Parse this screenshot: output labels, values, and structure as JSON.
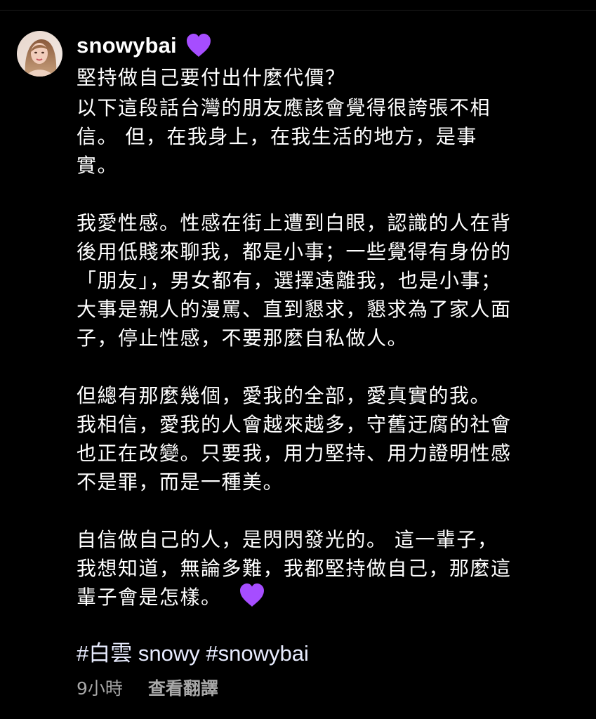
{
  "post": {
    "username": "snowybai",
    "title_heart_icon": "purple-heart-icon",
    "title": "堅持做自己要付出什麼代價？",
    "paragraphs": [
      [
        "以下這段話台灣的朋友應該會覺得很誇張不相",
        "信。 但，在我身上，在我生活的地方，是事",
        "實。"
      ],
      [
        "我愛性感。性感在街上遭到白眼，認識的人在背",
        "後用低賤來聊我，都是小事；一些覺得有身份的",
        "「朋友」，男女都有，選擇遠離我，也是小事；",
        "大事是親人的漫罵、直到懇求，懇求為了家人面",
        "子，停止性感，不要那麼自私做人。"
      ],
      [
        "但總有那麼幾個，愛我的全部，愛真實的我。",
        "我相信，愛我的人會越來越多，守舊迂腐的社會",
        "也正在改變。只要我，用力堅持、用力證明性感",
        "不是罪，而是一種美。"
      ],
      [
        "自信做自己的人，是閃閃發光的。 這一輩子，",
        "我想知道，無論多難，我都堅持做自己，那麼這",
        "輩子會是怎樣。"
      ]
    ],
    "hashtags": [
      "#白雲",
      "snowy",
      "#snowybai"
    ],
    "time_ago": "9小時",
    "translate_label": "查看翻譯",
    "colors": {
      "background": "#000000",
      "text": "#ffffff",
      "hashtag": "#e8ecff",
      "muted": "#a8a8a8",
      "heart": "#a64dff"
    }
  }
}
